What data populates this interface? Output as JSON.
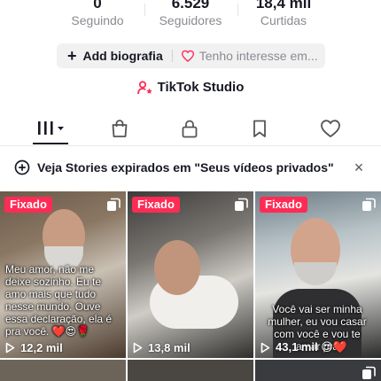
{
  "stats": [
    {
      "value": "0",
      "label": "Seguindo"
    },
    {
      "value": "6.529",
      "label": "Seguidores"
    },
    {
      "value": "18,4 mil",
      "label": "Curtidas"
    }
  ],
  "bio": {
    "add_label": "Add biografia",
    "interest_label": "Tenho interesse em..."
  },
  "studio": {
    "label": "TikTok Studio"
  },
  "tabs": [
    {
      "icon": "grid-icon",
      "active": true
    },
    {
      "icon": "shop-bag-icon",
      "active": false
    },
    {
      "icon": "lock-icon",
      "active": false
    },
    {
      "icon": "bookmark-icon",
      "active": false
    },
    {
      "icon": "heart-icon",
      "active": false
    }
  ],
  "banner": {
    "text": "Veja Stories expirados em \"Seus vídeos privados\"",
    "close": "×"
  },
  "videos": [
    {
      "pinned": "Fixado",
      "caption": "Meu amor, não me deixe sozinho. Eu te amo mais que tudo nesse mundo. Ouve essa declaração, ela é pra você. ❤️😍🌹",
      "views": "12,2 mil"
    },
    {
      "pinned": "Fixado",
      "caption": "",
      "views": "13,8 mil"
    },
    {
      "pinned": "Fixado",
      "caption": "Você vai ser minha mulher, eu vou casar com você e vou te amar pra",
      "views": "43,1 mil 😍❤️"
    }
  ],
  "colors": {
    "accent": "#fe2c55",
    "text": "#161823",
    "muted": "#8a8b91"
  }
}
